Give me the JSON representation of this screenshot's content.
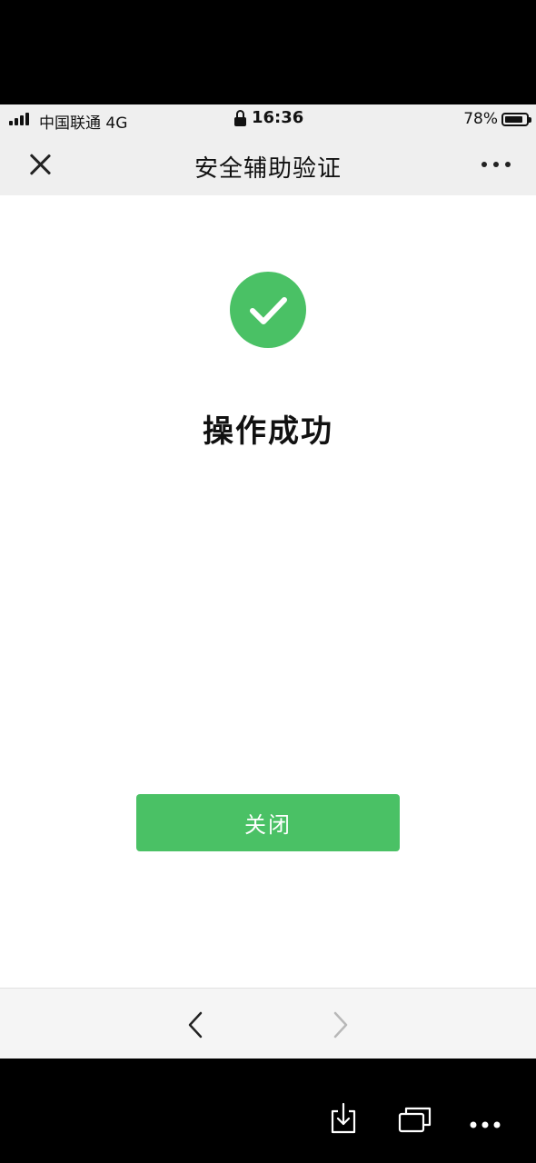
{
  "status_bar": {
    "carrier": "中国联通  4G",
    "time": "16:36",
    "battery": "78%"
  },
  "nav": {
    "title": "安全辅助验证",
    "close_icon": "close-icon",
    "more_icon": "more-icon"
  },
  "content": {
    "status_icon": "check-circle-icon",
    "result_text": "操作成功",
    "close_button_label": "关闭"
  },
  "browser_toolbar": {
    "back_icon": "chevron-left-icon",
    "forward_icon": "chevron-right-icon"
  },
  "os_toolbar": {
    "icons": [
      "download-icon",
      "window-switch-icon",
      "more-icon"
    ]
  },
  "colors": {
    "accent_green": "#4ac165",
    "header_bg": "#efefef",
    "toolbar_bg": "#f5f5f5"
  }
}
